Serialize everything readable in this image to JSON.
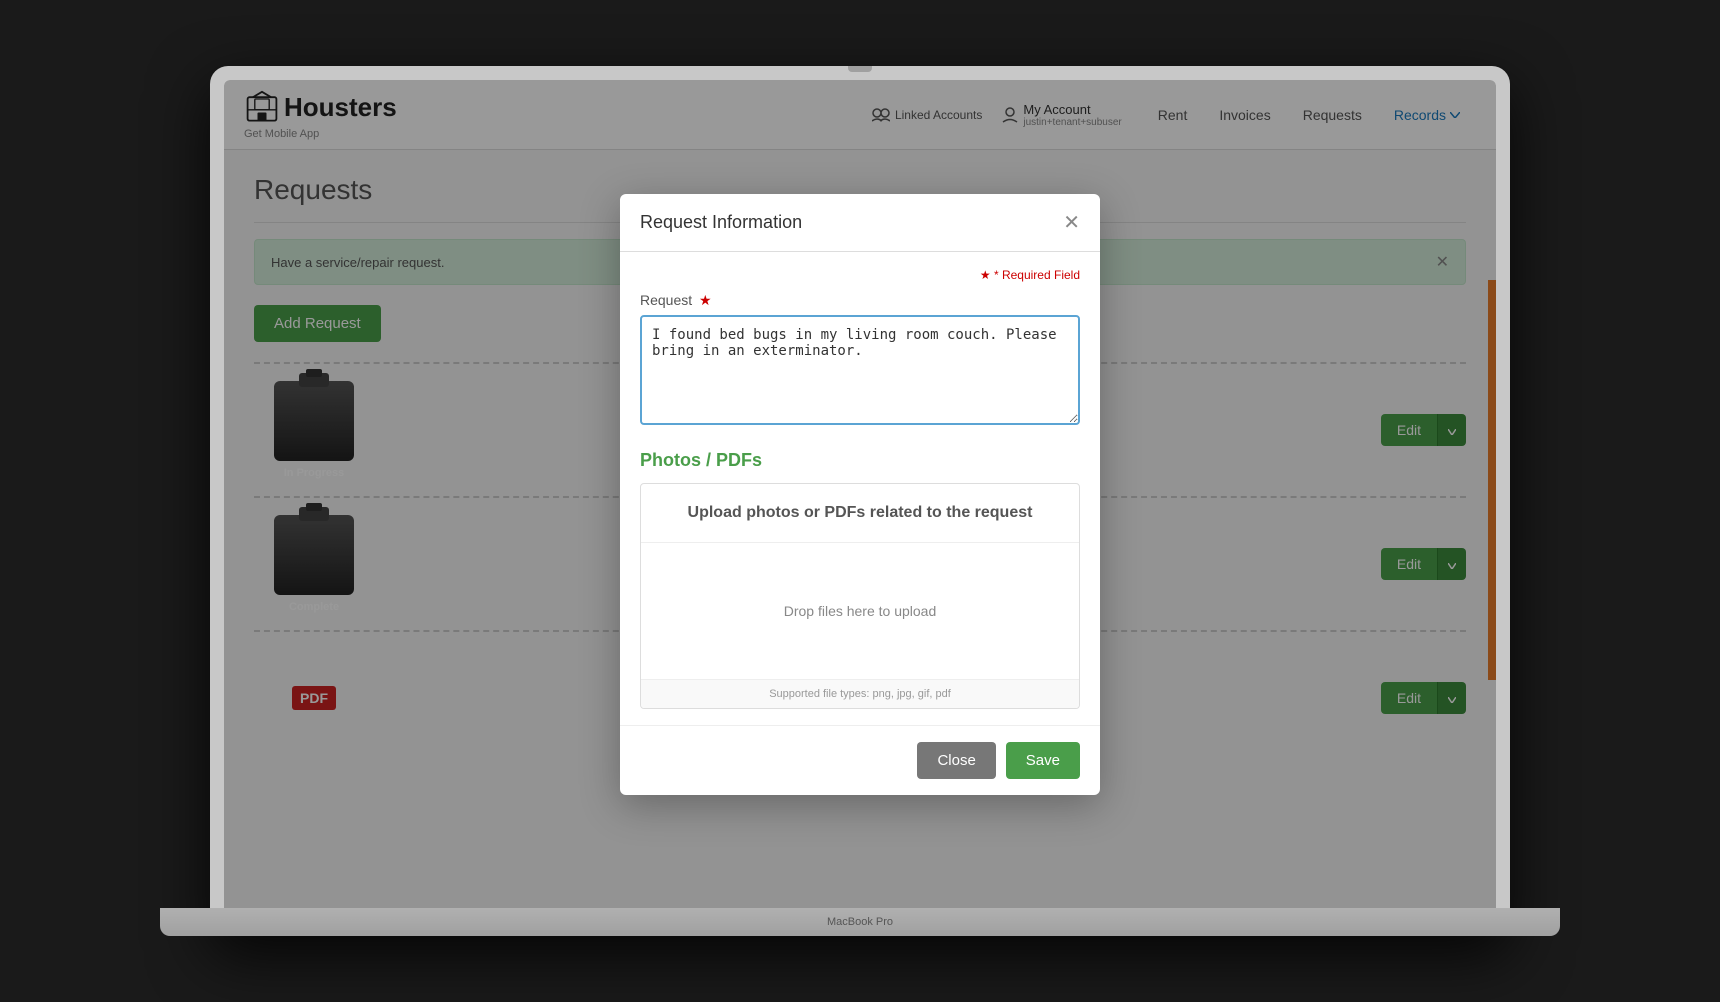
{
  "macbook": {
    "label": "MacBook Pro"
  },
  "header": {
    "logo": "Housters",
    "logo_subtitle": "Get Mobile App",
    "linked_accounts_label": "Linked Accounts",
    "my_account_label": "My Account",
    "my_account_user": "justin+tenant+subuser",
    "nav": [
      {
        "id": "rent",
        "label": "Rent"
      },
      {
        "id": "invoices",
        "label": "Invoices"
      },
      {
        "id": "requests",
        "label": "Requests"
      },
      {
        "id": "records",
        "label": "Records",
        "has_dropdown": true
      }
    ]
  },
  "main": {
    "page_title": "Requests",
    "info_banner": "Have a service/repair",
    "info_banner_suffix": "request.",
    "add_request_btn": "Add Request",
    "requests": [
      {
        "status": "In Progress",
        "edit_label": "Edit"
      },
      {
        "status": "Complete",
        "edit_label": "Edit"
      },
      {
        "status": "PDF",
        "edit_label": "Edit"
      }
    ]
  },
  "modal": {
    "title": "Request Information",
    "required_note": "* Required Field",
    "request_label": "Request",
    "request_required": "*",
    "request_value": "I found bed bugs in my living room couch. Please bring in an exterminator.",
    "photos_section_title": "Photos / PDFs",
    "upload_header": "Upload photos or PDFs related to the request",
    "upload_drop_text": "Drop files here to upload",
    "upload_supported": "Supported file types: png, jpg, gif, pdf",
    "close_btn": "Close",
    "save_btn": "Save"
  }
}
